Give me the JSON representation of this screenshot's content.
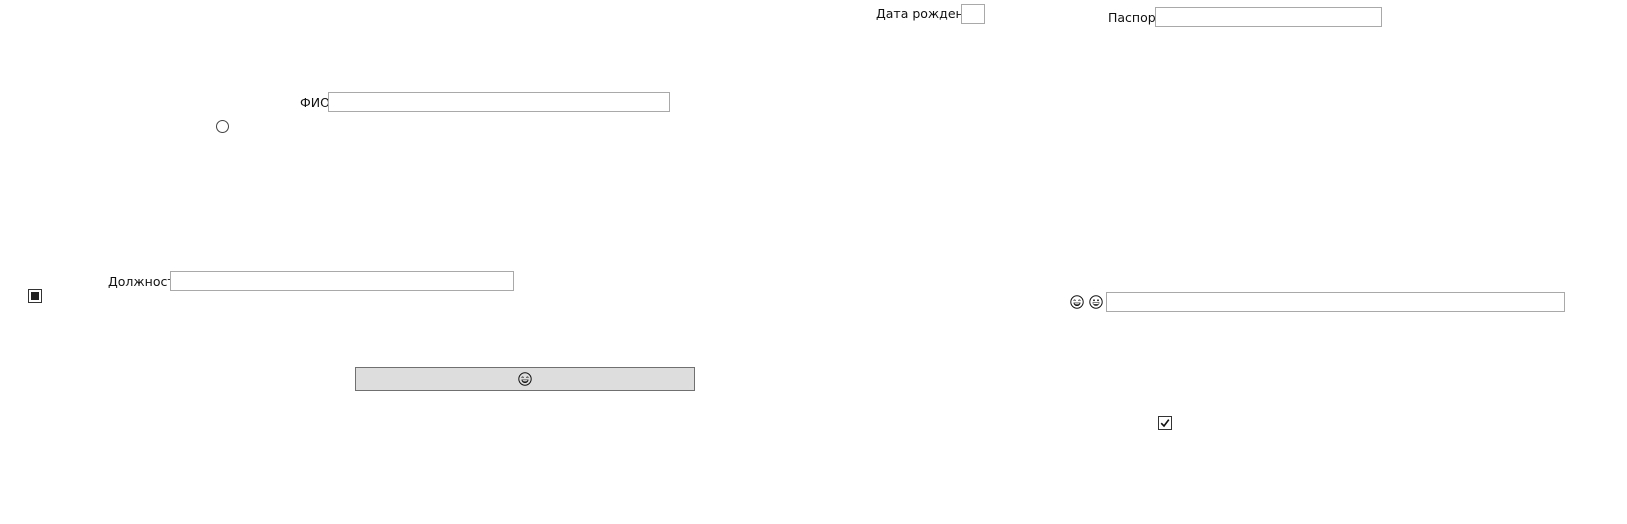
{
  "form": {
    "fio": {
      "label": "ФИО",
      "value": ""
    },
    "birth_date": {
      "label": "Дата рождения",
      "value": ""
    },
    "passport": {
      "label": "Паспорт",
      "value": ""
    },
    "position": {
      "label": "Должность",
      "value": ""
    },
    "emoji_field": {
      "value": ""
    },
    "radio": {
      "checked": false
    },
    "left_checkbox": {
      "state": "indeterminate"
    },
    "right_checkbox": {
      "state": "checked"
    },
    "button": {
      "icon": "laughing-face-icon"
    }
  },
  "icons": {
    "emoji_left": "laughing-face-icon",
    "emoji_right": "grinning-face-icon"
  }
}
